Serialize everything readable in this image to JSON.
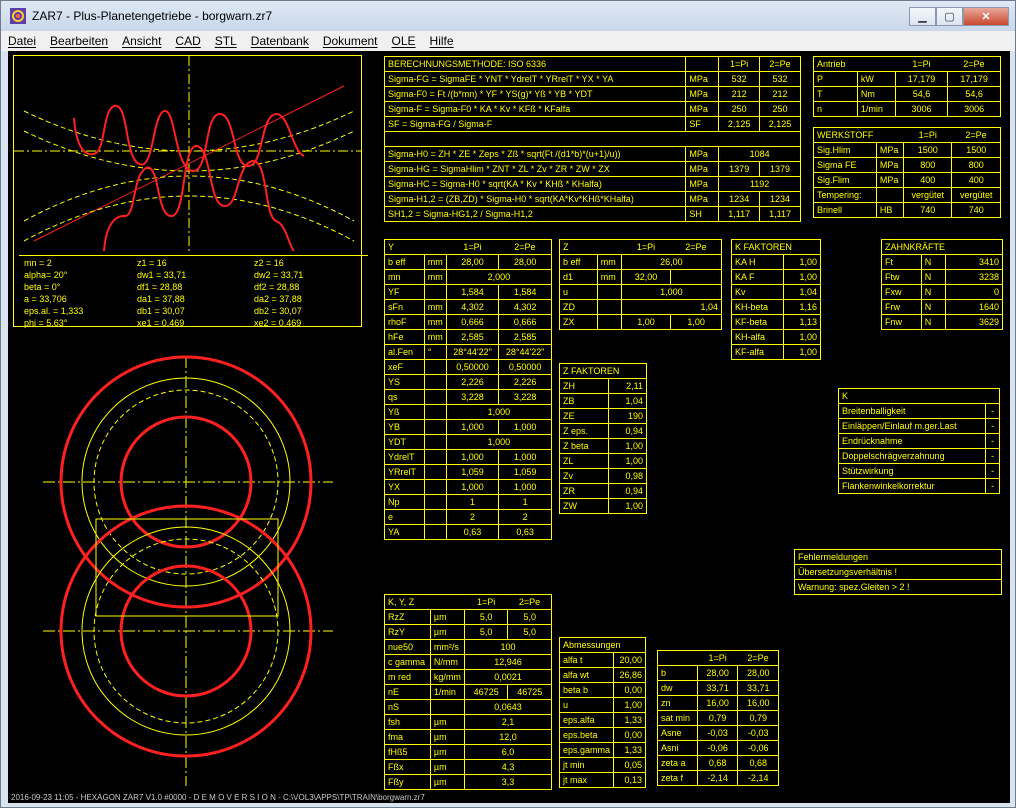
{
  "window": {
    "title": "ZAR7 - Plus-Planetengetriebe  -  borgwarn.zr7"
  },
  "menu": [
    "Datei",
    "Bearbeiten",
    "Ansicht",
    "CAD",
    "STL",
    "Datenbank",
    "Dokument",
    "OLE",
    "Hilfe"
  ],
  "status": "2016-09-23 11:05 - HEXAGON ZAR7 V1.0 #0000 - D E M O V E R S I O N - C:\\VOL3\\APPS\\TP\\TRAIN\\borgwarn.zr7",
  "gear_params": [
    [
      "mn = 2",
      "z1 = 16",
      "z2 = 16"
    ],
    [
      "alpha= 20°",
      "dw1 = 33,71",
      "dw2 = 33,71"
    ],
    [
      "beta = 0°",
      "df1 = 28,88",
      "df2 = 28,88"
    ],
    [
      "a = 33,706",
      "da1 = 37,88",
      "da2 = 37,88"
    ],
    [
      "eps.al. = 1,333",
      "db1 = 30,07",
      "db2 = 30,07"
    ],
    [
      "phi = 5,63°",
      "xe1 = 0,469",
      "xe2 = 0,469"
    ]
  ],
  "berechnung": {
    "header": [
      "BERECHNUNGSMETHODE:  ISO 6336",
      "",
      "1=Pi",
      "2=Pe"
    ],
    "rows1": [
      [
        "Sigma-FG = SigmaFE * YNT * YdrelT * YRrelT * YX * YA",
        "MPa",
        "532",
        "532"
      ],
      [
        "Sigma-F0 = Ft /(b*mn) * YF * YS(g)* Yß * YB * YDT",
        "MPa",
        "212",
        "212"
      ],
      [
        "Sigma-F = Sigma-F0 * KA * Kv * KFß * KFalfa",
        "MPa",
        "250",
        "250"
      ],
      [
        "SF = Sigma-FG / Sigma-F",
        "SF",
        "2,125",
        "2,125"
      ]
    ],
    "rows2": [
      [
        "Sigma-H0 = ZH * ZE * Zeps * Zß * sqrt(Ft /(d1*b)*(u+1)/u))",
        "MPa",
        "1084",
        ""
      ],
      [
        "Sigma-HG = SigmaHlim * ZNT * ZL * Zv * ZR * ZW * ZX",
        "MPa",
        "1379",
        "1379"
      ],
      [
        "Sigma-HC = Sigma-H0 * sqrt(KA * Kv * KHß * KHalfa)",
        "MPa",
        "1192",
        ""
      ],
      [
        "Sigma-H1,2 = (ZB,ZD) * Sigma-H0 * sqrt(KA*Kv*KHß*KHalfa)",
        "MPa",
        "1234",
        "1234"
      ],
      [
        "SH1,2 = Sigma-HG1,2 / Sigma-H1,2",
        "SH",
        "1,117",
        "1,117"
      ]
    ]
  },
  "antrieb": {
    "header": [
      "Antrieb",
      "",
      "1=Pi",
      "2=Pe"
    ],
    "rows": [
      [
        "P",
        "kW",
        "17,179",
        "17,179"
      ],
      [
        "T",
        "Nm",
        "54,6",
        "54,6"
      ],
      [
        "n",
        "1/min",
        "3006",
        "3006"
      ]
    ]
  },
  "werkstoff": {
    "header": [
      "WERKSTOFF",
      "",
      "1=Pi",
      "2=Pe"
    ],
    "rows": [
      [
        "Sig.Hlim",
        "MPa",
        "1500",
        "1500"
      ],
      [
        "Sigma FE",
        "MPa",
        "800",
        "800"
      ],
      [
        "Sig.Flim",
        "MPa",
        "400",
        "400"
      ],
      [
        "Tempering:",
        "",
        "vergütet",
        "vergütet"
      ],
      [
        "Brinell",
        "HB",
        "740",
        "740"
      ]
    ]
  },
  "ytable": {
    "header": [
      "Y",
      "",
      "1=Pi",
      "2=Pe"
    ],
    "rows": [
      [
        "b eff",
        "mm",
        "28,00",
        "28,00"
      ],
      [
        "mn",
        "mm",
        "2,000",
        ""
      ],
      [
        "YF",
        "",
        "1,584",
        "1,584"
      ],
      [
        "sFn",
        "mm",
        "4,302",
        "4,302"
      ],
      [
        "rhoF",
        "mm",
        "0,666",
        "0,666"
      ],
      [
        "hFe",
        "mm",
        "2,585",
        "2,585"
      ],
      [
        "al.Fen",
        "°",
        "28°44'22\"",
        "28°44'22\""
      ],
      [
        "xeF",
        "",
        "0,50000",
        "0,50000"
      ],
      [
        "YS",
        "",
        "2,226",
        "2,226"
      ],
      [
        "qs",
        "",
        "3,228",
        "3,228"
      ],
      [
        "Yß",
        "",
        "1,000",
        ""
      ],
      [
        "YB",
        "",
        "1,000",
        "1,000"
      ],
      [
        "YDT",
        "",
        "1,000",
        ""
      ],
      [
        "YdrelT",
        "",
        "1,000",
        "1,000"
      ],
      [
        "YRrelT",
        "",
        "1,059",
        "1,059"
      ],
      [
        "YX",
        "",
        "1,000",
        "1,000"
      ],
      [
        "Np",
        "",
        "1",
        "1"
      ],
      [
        "e",
        "",
        "2",
        "2"
      ],
      [
        "YA",
        "",
        "0,63",
        "0,63"
      ]
    ]
  },
  "ztable": {
    "header": [
      "Z",
      "",
      "1=Pi",
      "2=Pe"
    ],
    "rows": [
      [
        "b eff",
        "mm",
        "26,00",
        ""
      ],
      [
        "d1",
        "mm",
        "32,00",
        ""
      ],
      [
        "u",
        "",
        "1,000",
        ""
      ],
      [
        "ZD",
        "",
        "",
        "1,04"
      ],
      [
        "ZX",
        "",
        "1,00",
        "1,00"
      ]
    ]
  },
  "kfaktoren": {
    "header": "K FAKTOREN",
    "rows": [
      [
        "KA H",
        "1,00"
      ],
      [
        "KA F",
        "1,00"
      ],
      [
        "Kv",
        "1,04"
      ],
      [
        "KH-beta",
        "1,16"
      ],
      [
        "KF-beta",
        "1,13"
      ],
      [
        "KH-alfa",
        "1,00"
      ],
      [
        "KF-alfa",
        "1,00"
      ]
    ]
  },
  "zahnkraefte": {
    "header": "ZAHNKRÄFTE",
    "rows": [
      [
        "Ft",
        "N",
        "3410"
      ],
      [
        "Ftw",
        "N",
        "3238"
      ],
      [
        "Fxw",
        "N",
        "0"
      ],
      [
        "Frw",
        "N",
        "1640"
      ],
      [
        "Fnw",
        "N",
        "3629"
      ]
    ]
  },
  "zfaktoren": {
    "header": "Z FAKTOREN",
    "rows": [
      [
        "ZH",
        "2,11"
      ],
      [
        "ZB",
        "1,04"
      ],
      [
        "ZE",
        "190"
      ],
      [
        "Z eps.",
        "0,94"
      ],
      [
        "Z beta",
        "1,00"
      ],
      [
        "ZL",
        "1,00"
      ],
      [
        "Zv",
        "0,98"
      ],
      [
        "ZR",
        "0,94"
      ],
      [
        "ZW",
        "1,00"
      ]
    ]
  },
  "ktable": {
    "header": "K",
    "rows": [
      [
        "Breitenballigkeit",
        "-"
      ],
      [
        "Einläppen/Einlauf m.ger.Last",
        "-"
      ],
      [
        "Endrücknahme",
        "-"
      ],
      [
        "Doppelschrägverzahnung",
        "-"
      ],
      [
        "Stützwirkung",
        "-"
      ],
      [
        "Flankenwinkelkorrektur",
        "-"
      ]
    ]
  },
  "fehler": {
    "rows": [
      "Fehlermeldungen",
      "Übersetzungsverhältnis !",
      "Warnung: spez.Gleiten > 2 !"
    ]
  },
  "kyz": {
    "header": [
      "K, Y, Z",
      "",
      "1=Pi",
      "2=Pe"
    ],
    "rows": [
      [
        "RzZ",
        "µm",
        "5,0",
        "5,0"
      ],
      [
        "RzY",
        "µm",
        "5,0",
        "5,0"
      ],
      [
        "nue50",
        "mm²/s",
        "100",
        ""
      ],
      [
        "c gamma",
        "N/mm",
        "12,946",
        ""
      ],
      [
        "m red",
        "kg/mm",
        "0,0021",
        ""
      ],
      [
        "nE",
        "1/min",
        "46725",
        "46725"
      ],
      [
        "nS",
        "",
        "0,0643",
        ""
      ],
      [
        "fsh",
        "µm",
        "2,1",
        ""
      ],
      [
        "fma",
        "µm",
        "12,0",
        ""
      ],
      [
        "fHß5",
        "µm",
        "6,0",
        ""
      ],
      [
        "Fßx",
        "µm",
        "4,3",
        ""
      ],
      [
        "Fßy",
        "µm",
        "3,3",
        ""
      ]
    ]
  },
  "abmessungen": {
    "header": "Abmessungen",
    "rows": [
      [
        "alfa t",
        "20,00"
      ],
      [
        "alfa wt",
        "26,86"
      ],
      [
        "beta b",
        "0,00"
      ],
      [
        "u",
        "1,00"
      ],
      [
        "eps.alfa",
        "1,33"
      ],
      [
        "eps.beta",
        "0,00"
      ],
      [
        "eps.gamma",
        "1,33"
      ],
      [
        "jt min",
        "0,05"
      ],
      [
        "jt max",
        "0,13"
      ]
    ]
  },
  "geom": {
    "header": [
      "",
      "1=Pi",
      "2=Pe"
    ],
    "rows": [
      [
        "b",
        "28,00",
        "28,00"
      ],
      [
        "dw",
        "33,71",
        "33,71"
      ],
      [
        "zn",
        "16,00",
        "16,00"
      ],
      [
        "sat min",
        "0,79",
        "0,79"
      ],
      [
        "Asne",
        "-0,03",
        "-0,03"
      ],
      [
        "Asni",
        "-0,06",
        "-0,06"
      ],
      [
        "zeta a",
        "0,68",
        "0,68"
      ],
      [
        "zeta f",
        "-2,14",
        "-2,14"
      ]
    ]
  }
}
